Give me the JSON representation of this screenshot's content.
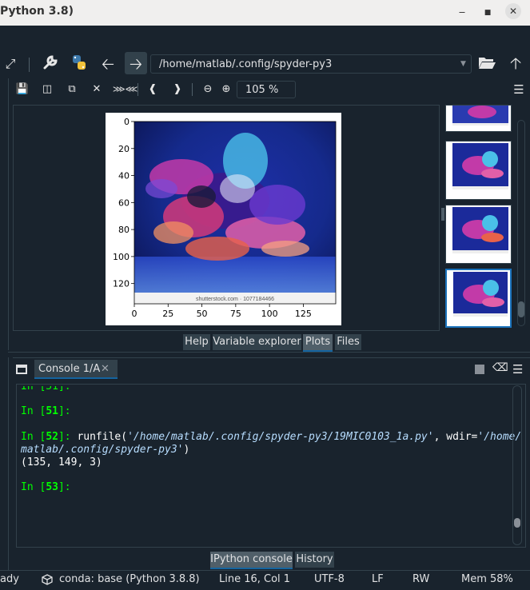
{
  "window": {
    "title": "Python 3.8)"
  },
  "toolbar": {
    "path": "/home/matlab/.config/spyder-py3"
  },
  "plots": {
    "zoom": "105 %",
    "figure": {
      "x_ticks": [
        "0",
        "25",
        "50",
        "75",
        "100",
        "125"
      ],
      "y_ticks": [
        "0",
        "20",
        "40",
        "60",
        "80",
        "100",
        "120"
      ],
      "watermark": "shutterstock.com · 1077184466"
    },
    "thumbnails": 4
  },
  "upper_tabs": [
    {
      "label": "Help",
      "active": false
    },
    {
      "label": "Variable explorer",
      "active": false
    },
    {
      "label": "Plots",
      "active": true
    },
    {
      "label": "Files",
      "active": false
    }
  ],
  "console": {
    "tab_label": "Console 1/A",
    "lines": {
      "l0": "In [51]:",
      "l1_prompt": "In [",
      "l1_num": "51",
      "l1_end": "]:",
      "l2_prompt": "In [",
      "l2_num": "52",
      "l2_end": "]:",
      "l2_code_a": " runfile(",
      "l2_str1": "'/home/matlab/.config/spyder-py3/19MIC0103_1a.py'",
      "l2_code_b": ", wdir=",
      "l2_str2a": "'/home/",
      "l3_str2b": "matlab/.config/spyder-py3'",
      "l3_code": ")",
      "l4": "(135, 149, 3)",
      "l5_prompt": "In [",
      "l5_num": "53",
      "l5_end": "]:"
    }
  },
  "lower_tabs": [
    {
      "label": "IPython console",
      "active": true
    },
    {
      "label": "History",
      "active": false
    }
  ],
  "statusbar": {
    "ready": "ady",
    "conda": "conda: base (Python 3.8.8)",
    "position": "Line 16, Col 1",
    "encoding": "UTF-8",
    "eol": "LF",
    "mode": "RW",
    "memory": "Mem 58%"
  },
  "colors": {
    "background": "#19232d",
    "border": "#32414b",
    "accent": "#1464a0",
    "prompt": "#00ff00"
  }
}
